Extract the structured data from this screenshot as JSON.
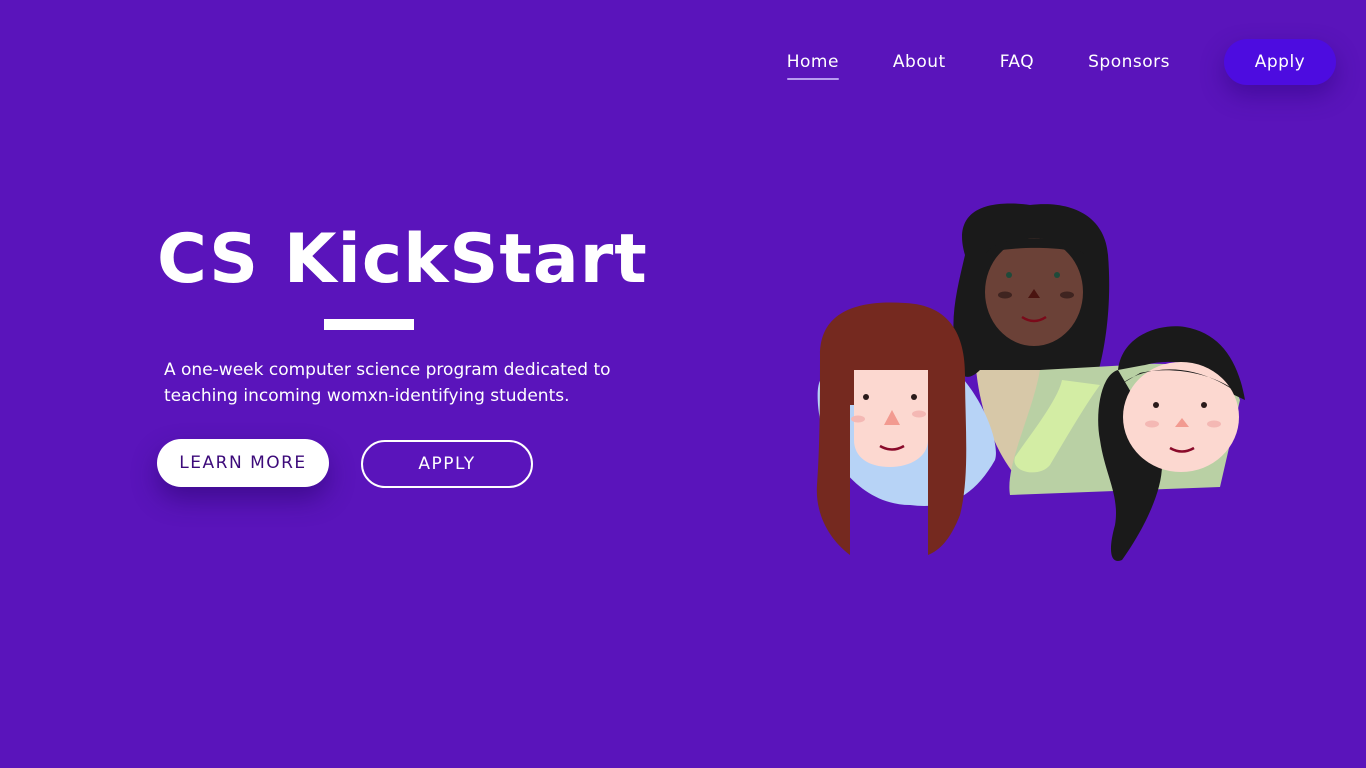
{
  "nav": {
    "items": [
      {
        "label": "Home",
        "active": true
      },
      {
        "label": "About",
        "active": false
      },
      {
        "label": "FAQ",
        "active": false
      },
      {
        "label": "Sponsors",
        "active": false
      }
    ],
    "apply_label": "Apply"
  },
  "hero": {
    "title": "CS KickStart",
    "description": "A one-week computer science program dedicated to teaching incoming womxn-identifying students.",
    "learn_more_label": "LEARN MORE",
    "apply_label": "APPLY"
  },
  "colors": {
    "background": "#5a14bb",
    "nav_button": "#4d0ce0",
    "text": "#ffffff",
    "learn_more_text": "#3c0a7a"
  },
  "illustration": {
    "icon": "three-women-illustration"
  }
}
